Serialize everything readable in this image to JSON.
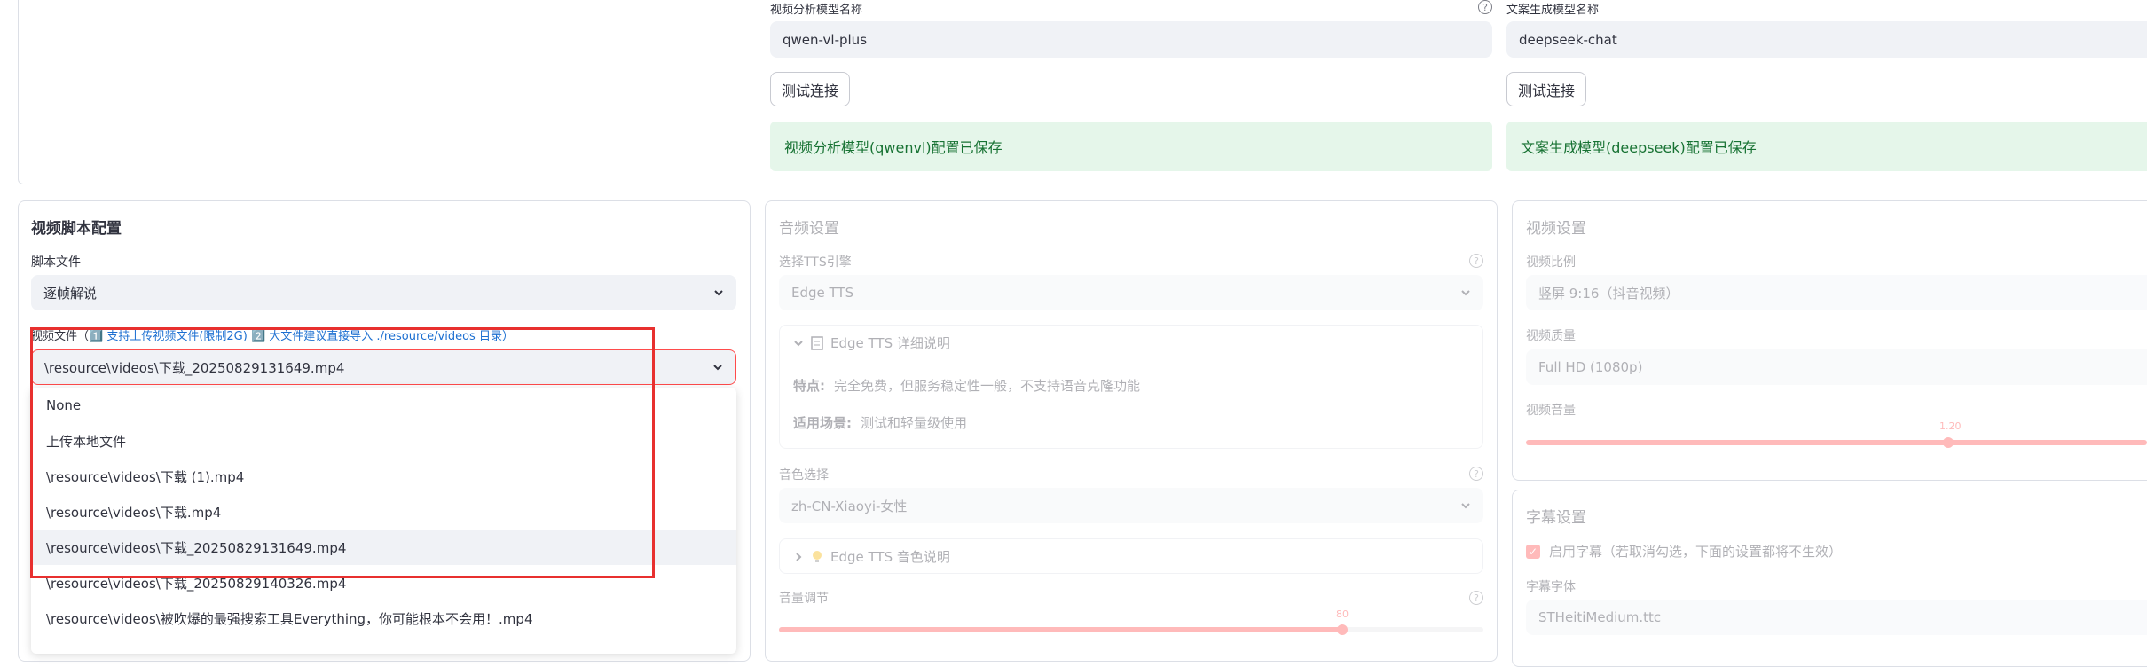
{
  "top": {
    "video_model_label": "视频分析模型名称",
    "video_model_value": "qwen-vl-plus",
    "copy_model_label": "文案生成模型名称",
    "copy_model_value": "deepseek-chat",
    "test_button": "测试连接",
    "video_model_saved": "视频分析模型(qwenvl)配置已保存",
    "copy_model_saved": "文案生成模型(deepseek)配置已保存"
  },
  "script_config": {
    "title": "视频脚本配置",
    "script_file_label": "脚本文件",
    "script_file_value": "逐帧解说",
    "video_file_label_prefix": "视频文件（",
    "video_file_label_hint": "1️⃣ 支持上传视频文件(限制2G) 2️⃣ 大文件建议直接导入 ./resource/videos 目录）",
    "video_file_value": "\\resource\\videos\\下载_20250829131649.mp4",
    "options": [
      "None",
      "上传本地文件",
      "\\resource\\videos\\下载 (1).mp4",
      "\\resource\\videos\\下载.mp4",
      "\\resource\\videos\\下载_20250829131649.mp4",
      "\\resource\\videos\\下载_20250829140326.mp4",
      "\\resource\\videos\\被吹爆的最强搜索工具Everything，你可能根本不会用！.mp4"
    ],
    "selected_index": 4
  },
  "audio": {
    "title": "音频设置",
    "tts_label": "选择TTS引擎",
    "tts_value": "Edge TTS",
    "tts_detail_title": "Edge TTS 详细说明",
    "feature_label": "特点:",
    "feature_text": "完全免费，但服务稳定性一般，不支持语音克隆功能",
    "scene_label": "适用场景:",
    "scene_text": "测试和轻量级使用",
    "voice_label": "音色选择",
    "voice_value": "zh-CN-Xiaoyi-女性",
    "voice_detail_title": "Edge TTS 音色说明",
    "volume_label": "音量调节",
    "volume_value": "80",
    "volume_fraction": 0.8
  },
  "video": {
    "title": "视频设置",
    "ratio_label": "视频比例",
    "ratio_value": "竖屏 9:16（抖音视频）",
    "quality_label": "视频质量",
    "quality_value": "Full HD (1080p)",
    "volume_label": "视频音量",
    "volume_value": "1.20"
  },
  "subtitle": {
    "title": "字幕设置",
    "enable_label": "启用字幕（若取消勾选，下面的设置都将不生效）",
    "font_label": "字幕字体",
    "font_value": "STHeitiMedium.ttc"
  },
  "colors": {
    "accent": "#ff4b4b",
    "success_bg": "#e5f6ea",
    "success_text": "#177233",
    "hint_blue": "#1c6fd1"
  }
}
